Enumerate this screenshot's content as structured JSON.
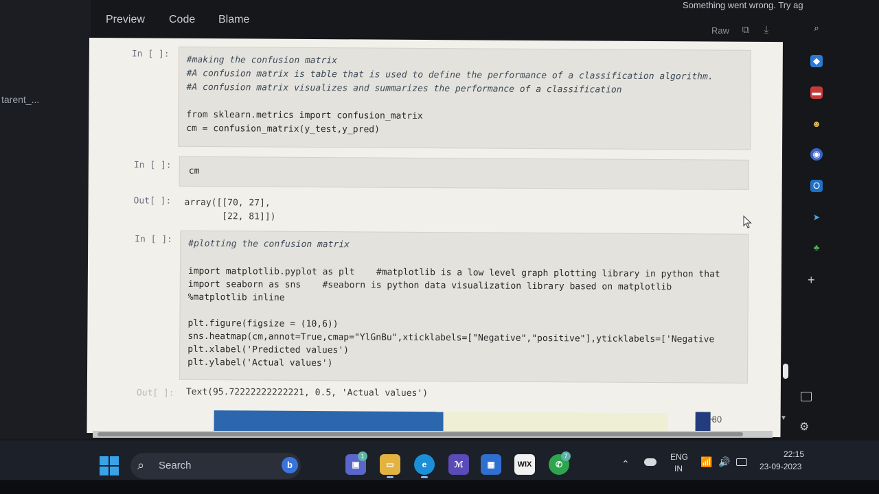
{
  "header": {
    "tabs": [
      "Preview",
      "Code",
      "Blame"
    ],
    "error_message": "Something went wrong. Try ag",
    "raw_label": "Raw",
    "copy_icon": "copy-icon",
    "download_icon": "download-icon"
  },
  "left_pane": {
    "label": "tarent_..."
  },
  "notebook": {
    "cell1": {
      "prompt": "In [ ]:",
      "lines": [
        "#making the confusion matrix",
        "#A confusion matrix is table that is used to define the performance of a classification algorithm.",
        "#A confusion matrix visualizes and summarizes the performance of a classification",
        "",
        "from sklearn.metrics import confusion_matrix",
        "cm = confusion_matrix(y_test,y_pred)"
      ]
    },
    "cell2": {
      "prompt": "In [ ]:",
      "code": "cm",
      "out_prompt": "Out[ ]:",
      "output_lines": [
        "array([[70, 27],",
        "       [22, 81]])"
      ]
    },
    "cell3": {
      "prompt": "In [ ]:",
      "lines": [
        "#plotting the confusion matrix",
        "",
        "import matplotlib.pyplot as plt    #matplotlib is a low level graph plotting library in python that",
        "import seaborn as sns    #seaborn is python data visualization library based on matplotlib",
        "%matplotlib inline",
        "",
        "plt.figure(figsize = (10,6))",
        "sns.heatmap(cm,annot=True,cmap=\"YlGnBu\",xticklabels=[\"Negative\",\"positive\"],yticklabels=['Negative",
        "plt.xlabel('Predicted values')",
        "plt.ylabel('Actual values')"
      ],
      "out_prompt": "Out[ ]:",
      "output": "Text(95.72222222222221, 0.5, 'Actual values')",
      "colorbar_tick": "80"
    }
  },
  "taskbar": {
    "search_placeholder": "Search",
    "apps": [
      {
        "name": "teams-chat-icon",
        "badge": "1"
      },
      {
        "name": "file-explorer-icon"
      },
      {
        "name": "edge-browser-icon"
      },
      {
        "name": "visual-studio-icon"
      },
      {
        "name": "microsoft-store-icon"
      },
      {
        "name": "wix-icon",
        "label": "WIX"
      },
      {
        "name": "whatsapp-icon",
        "badge": "7"
      }
    ],
    "lang_line1": "ENG",
    "lang_line2": "IN",
    "time": "22:15",
    "date": "23-09-2023"
  },
  "colors": {
    "accent_blue": "#2c67ad",
    "taskbar_bg": "#1c2029",
    "notebook_bg": "#f2f0ea"
  }
}
